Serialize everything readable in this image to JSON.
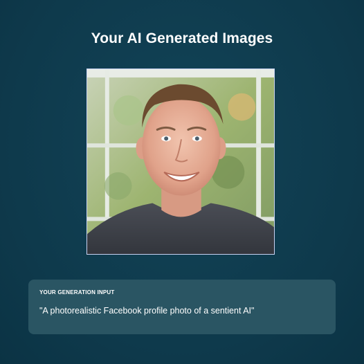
{
  "header": {
    "title": "Your AI Generated Images"
  },
  "generated_image": {
    "subject": "portrait-photo",
    "border_color": "#c9d3f3"
  },
  "generation_input": {
    "label": "YOUR GENERATION INPUT",
    "prompt": "\"A photorealistic Facebook profile photo of a sentient AI\""
  },
  "colors": {
    "background": "#0f3b4e",
    "card": "#2a5563",
    "text": "#ffffff"
  }
}
